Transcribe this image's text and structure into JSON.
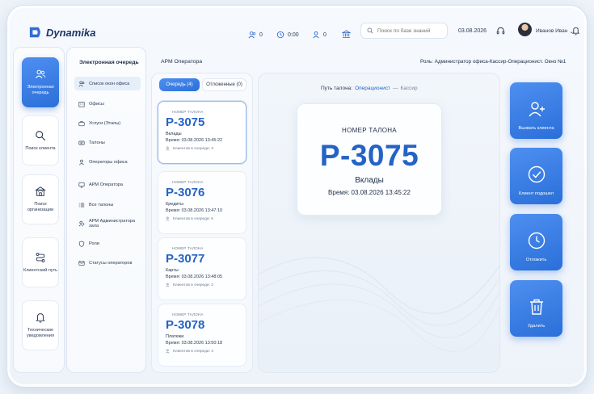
{
  "app": {
    "logo": "Dynamika"
  },
  "topbar": {
    "stats": [
      {
        "icon": "users-icon",
        "value": "0"
      },
      {
        "icon": "clock-icon",
        "value": "0:00"
      },
      {
        "icon": "user-icon",
        "value": "0"
      }
    ],
    "search_placeholder": "Поиск по базе знаний",
    "date": "03.08.2026",
    "user_name": "Иванов Иван",
    "user_chevron": "⌄"
  },
  "leftnav": [
    {
      "label": "Электронная очередь",
      "icon": "people-icon"
    },
    {
      "label": "Поиск клиента",
      "icon": "search-icon"
    },
    {
      "label": "Поиск организации",
      "icon": "building-icon"
    },
    {
      "label": "Клиентский путь",
      "icon": "route-icon"
    },
    {
      "label": "Технические уведомления",
      "icon": "bell-icon"
    }
  ],
  "menu": {
    "title": "Электронная очередь",
    "items": [
      {
        "label": "Список окон офиса",
        "icon": "users-icon"
      },
      {
        "label": "Офисы",
        "icon": "office-icon"
      },
      {
        "label": "Услуги (Этапы)",
        "icon": "briefcase-icon"
      },
      {
        "label": "Талоны",
        "icon": "ticket-icon"
      },
      {
        "label": "Операторы офиса",
        "icon": "operators-icon"
      },
      {
        "label": "АРМ Оператора",
        "icon": "monitor-icon"
      },
      {
        "label": "Все талоны",
        "icon": "list-icon"
      },
      {
        "label": "АРМ Администратора зала",
        "icon": "admin-icon"
      },
      {
        "label": "Роли",
        "icon": "shield-icon"
      },
      {
        "label": "Статусы операторов",
        "icon": "mail-icon"
      }
    ]
  },
  "main": {
    "title": "АРМ Оператора",
    "role": "Роль: Администратор офиса-Кассир-Операционист. Окно №1",
    "tabs": [
      "Очередь (4)",
      "Отложенные (0)"
    ],
    "tickets": [
      {
        "caption": "НОМЕР ТАЛОНА",
        "number": "Р-3075",
        "service": "Вклады",
        "time": "Время: 03.08.2026 13:45:22",
        "queue": "Клиентов в очереди: 3"
      },
      {
        "caption": "НОМЕР ТАЛОНА",
        "number": "Р-3076",
        "service": "Кредиты",
        "time": "Время: 03.08.2026 13:47:10",
        "queue": "Клиентов в очереди: 5"
      },
      {
        "caption": "НОМЕР ТАЛОНА",
        "number": "Р-3077",
        "service": "Карты",
        "time": "Время: 03.08.2026 13:48:05",
        "queue": "Клиентов в очереди: 2"
      },
      {
        "caption": "НОМЕР ТАЛОНА",
        "number": "Р-3078",
        "service": "Платежи",
        "time": "Время: 03.08.2026 13:50:18",
        "queue": "Клиентов в очереди: 4"
      }
    ],
    "path": {
      "label": "Путь талона:",
      "current": "Операционист",
      "separator": "—",
      "next": "Кассир"
    },
    "current": {
      "caption": "НОМЕР ТАЛОНА",
      "number": "Р-3075",
      "service": "Вклады",
      "time": "Время: 03.08.2026 13:45:22"
    },
    "actions": [
      {
        "label": "Вызвать клиента",
        "icon": "add-user-icon"
      },
      {
        "label": "Клиент подошел",
        "icon": "check-circle-icon"
      },
      {
        "label": "Отложить",
        "icon": "clock-icon"
      },
      {
        "label": "Удалить",
        "icon": "trash-icon"
      }
    ]
  }
}
